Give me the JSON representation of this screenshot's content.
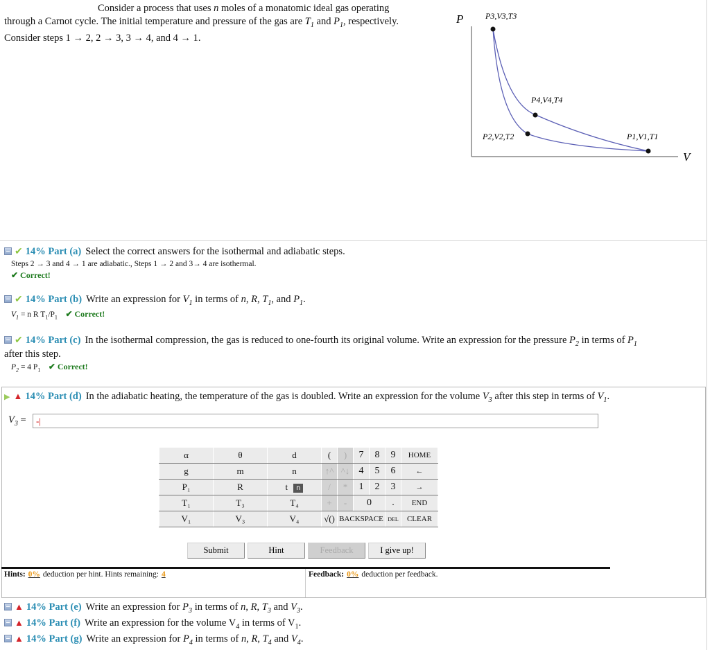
{
  "intro": {
    "line1": "Consider a process that uses n moles of a monatomic ideal gas operating",
    "line2": "through a Carnot cycle. The initial temperature and pressure of the gas are T1 and P1, respectively.",
    "line3": "Consider steps 1 → 2, 2 → 3, 3 → 4, and 4 → 1."
  },
  "graph": {
    "axis_p": "P",
    "axis_v": "V",
    "points": [
      {
        "label": "P3,V3,T3"
      },
      {
        "label": "P4,V4,T4"
      },
      {
        "label": "P2,V2,T2"
      },
      {
        "label": "P1,V1,T1"
      }
    ],
    "curve_color": "#5b5fb5"
  },
  "parts": {
    "a": {
      "percent": "14%",
      "label": "Part (a)",
      "question": "Select the correct answers for the isothermal and adiabatic steps.",
      "answer": "Steps 2 → 3 and 4 → 1 are adiabatic., Steps 1 → 2 and 3→ 4 are isothermal.",
      "status": "✔ Correct!"
    },
    "b": {
      "percent": "14%",
      "label": "Part (b)",
      "question_pre": "Write an expression for ",
      "question_var": "V",
      "question_sub": "1",
      "question_post": " in terms of n, R, T1, and P1.",
      "answer": "V1 = n R T1/P1",
      "status": "✔ Correct!"
    },
    "c": {
      "percent": "14%",
      "label": "Part (c)",
      "question": "In the isothermal compression, the gas is reduced to one-fourth its original volume. Write an expression for the pressure P2 in terms of P1",
      "question_cont": "after this step.",
      "answer": "P2 = 4 P1",
      "status": "✔ Correct!"
    },
    "d": {
      "percent": "14%",
      "label": "Part (d)",
      "question": "In the adiabatic heating, the temperature of the gas is doubled. Write an expression for the volume V3 after this step in terms of V1.",
      "input_label": "V3 =",
      "input_value": "-|"
    },
    "e": {
      "percent": "14%",
      "label": "Part (e)",
      "question": "Write an expression for P3 in terms of n, R, T3 and V3."
    },
    "f": {
      "percent": "14%",
      "label": "Part (f)",
      "question": "Write an expression for the volume V4 in terms of V1."
    },
    "g": {
      "percent": "14%",
      "label": "Part (g)",
      "question": "Write an expression for P4 in terms of n, R, T4 and V4."
    }
  },
  "keypad": {
    "vars": [
      [
        "α",
        "θ",
        "d"
      ],
      [
        "g",
        "m",
        "n"
      ],
      [
        "P₁",
        "R",
        "t"
      ],
      [
        "T₁",
        "T₃",
        "T₄"
      ],
      [
        "V₁",
        "V₃",
        "V₄"
      ]
    ],
    "tooltip": "n",
    "ops": [
      [
        "(",
        ")"
      ],
      [
        "↑^",
        "^↓"
      ],
      [
        "/",
        "*"
      ],
      [
        "+",
        "-"
      ],
      [
        "√()"
      ]
    ],
    "nums": [
      [
        "7",
        "8",
        "9"
      ],
      [
        "4",
        "5",
        "6"
      ],
      [
        "1",
        "2",
        "3"
      ],
      [
        "0",
        "."
      ]
    ],
    "cmds": [
      "HOME",
      "←",
      "→",
      "END",
      "CLEAR"
    ],
    "backspace": "BACKSPACE",
    "del": "DEL"
  },
  "buttons": {
    "submit": "Submit",
    "hint": "Hint",
    "feedback": "Feedback",
    "give_up": "I give up!"
  },
  "hints": {
    "label": "Hints:",
    "deduction": "0%",
    "text": "deduction per hint. Hints remaining:",
    "remaining": "4"
  },
  "feedback": {
    "label": "Feedback:",
    "deduction": "0%",
    "text": "deduction per feedback."
  }
}
